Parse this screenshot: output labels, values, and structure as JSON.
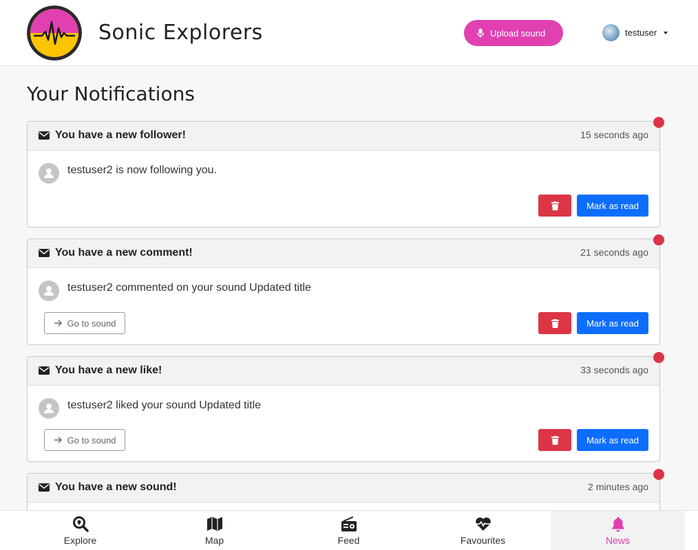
{
  "header": {
    "brand": "Sonic Explorers",
    "upload_label": "Upload sound",
    "username": "testuser",
    "accent_color": "#e040b0"
  },
  "page": {
    "title": "Your Notifications"
  },
  "notifications": [
    {
      "title": "You have a new follower!",
      "time": "15 seconds ago",
      "message": "testuser2 is now following you.",
      "mark_read_label": "Mark as read",
      "unread": true
    },
    {
      "title": "You have a new comment!",
      "time": "21 seconds ago",
      "message": "testuser2 commented on your sound Updated title",
      "goto_label": "Go to sound",
      "mark_read_label": "Mark as read",
      "unread": true
    },
    {
      "title": "You have a new like!",
      "time": "33 seconds ago",
      "message": "testuser2 liked your sound Updated title",
      "goto_label": "Go to sound",
      "mark_read_label": "Mark as read",
      "unread": true
    },
    {
      "title": "You have a new sound!",
      "time": "2 minutes ago",
      "unread": true
    }
  ],
  "bottom_nav": {
    "items": [
      {
        "label": "Explore",
        "icon": "search-location-icon"
      },
      {
        "label": "Map",
        "icon": "map-icon"
      },
      {
        "label": "Feed",
        "icon": "radio-icon"
      },
      {
        "label": "Favourites",
        "icon": "heartbeat-icon"
      },
      {
        "label": "News",
        "icon": "bell-icon",
        "active": true
      }
    ]
  },
  "colors": {
    "danger": "#dc3545",
    "primary": "#0d6efd",
    "unread_dot": "#dc3545"
  }
}
